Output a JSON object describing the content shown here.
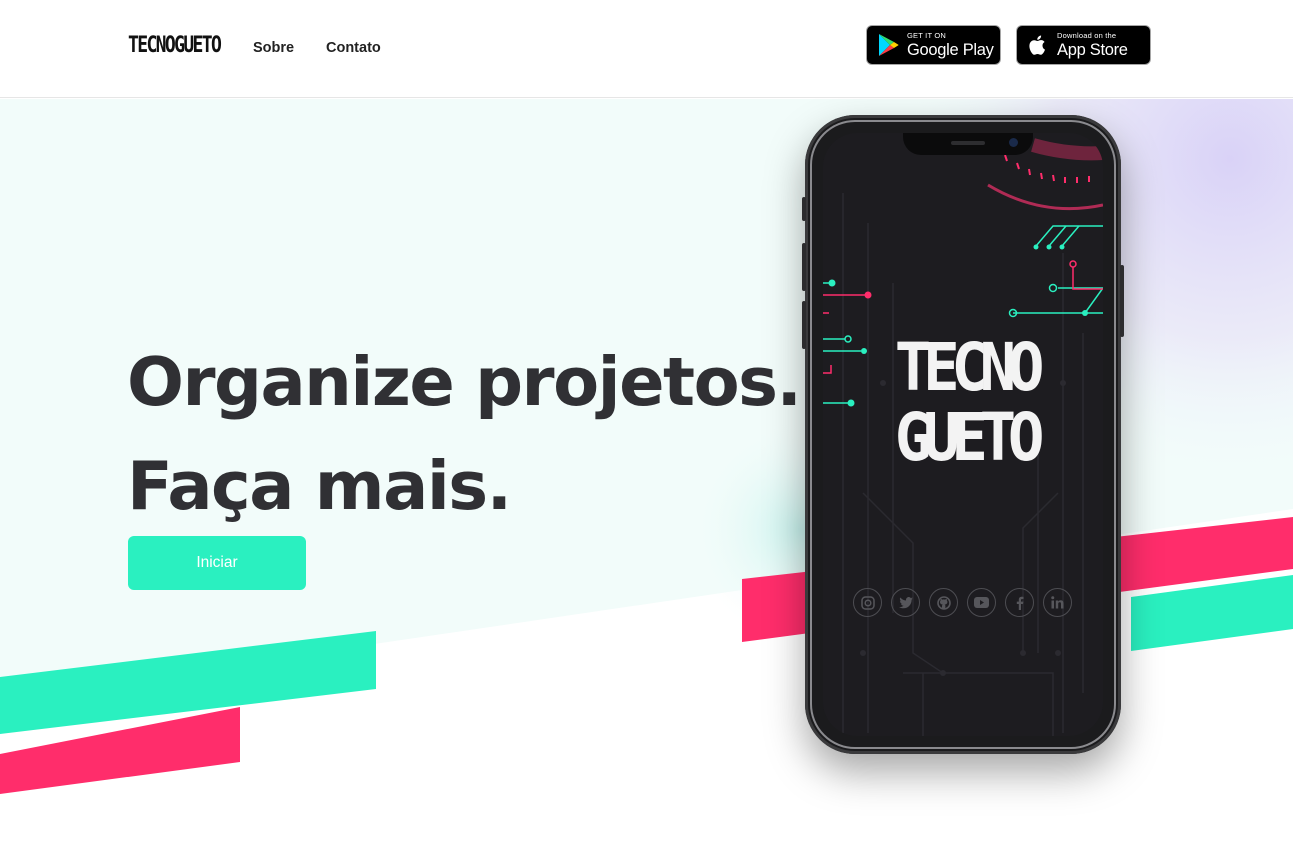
{
  "header": {
    "logo_text": "TECNOGUETO",
    "nav": [
      {
        "label": "Sobre"
      },
      {
        "label": "Contato"
      }
    ],
    "google_play": {
      "small": "GET IT ON",
      "big": "Google Play"
    },
    "app_store": {
      "small": "Download on the",
      "big": "App Store"
    }
  },
  "hero": {
    "headline_line1": "Organize projetos.",
    "headline_line2": "Faça mais.",
    "cta_label": "Iniciar"
  },
  "phone": {
    "logo_line1": "TECNO",
    "logo_line2": "GUETO",
    "social_icons": [
      "instagram-icon",
      "twitter-icon",
      "github-icon",
      "youtube-icon",
      "facebook-icon",
      "linkedin-icon"
    ]
  },
  "colors": {
    "accent_mint": "#2af0c0",
    "accent_pink": "#ff2d6b",
    "lavender": "#dcd6f7",
    "hero_bg": "#f2fcfa",
    "text_dark": "#303034"
  }
}
